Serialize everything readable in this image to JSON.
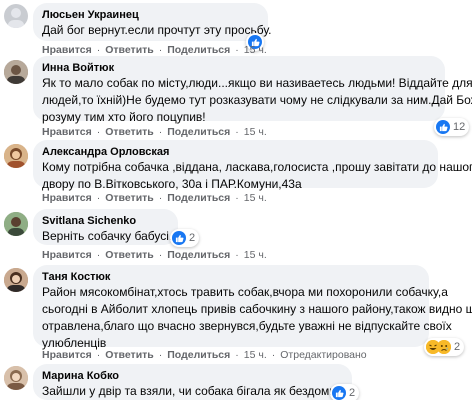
{
  "comments": [
    {
      "name": "Люсьен Украинец",
      "lines": [
        "Дай бог вернут.если прочтут эту просьбу."
      ],
      "actions": {
        "like": "Нравится",
        "reply": "Ответить",
        "share": "Поделиться",
        "time": "15 ч."
      },
      "reactions": {
        "count": ""
      }
    },
    {
      "name": "Инна Войтюк",
      "lines": [
        "Як то мало собак по місту,люди...якщо ви називаетесь людьми! Віддайте для",
        "людей,то їхній)Не будемо тут розказувати чому не слідкували за ним.Дай Боже",
        "розуму тим хто його поцупив!"
      ],
      "actions": {
        "like": "Нравится",
        "reply": "Ответить",
        "share": "Поделиться",
        "time": "15 ч."
      },
      "reactions": {
        "count": "12"
      }
    },
    {
      "name": "Александра Орловская",
      "lines": [
        "Кому потрібна собачка ,віддана, ласкава,голосиста ,прошу завітати до нашого",
        "двору по В.Вітковського, 30а і ПАР.Комуни,43а"
      ],
      "actions": {
        "like": "Нравится",
        "reply": "Ответить",
        "share": "Поделиться",
        "time": "15 ч."
      },
      "reactions": {
        "count": ""
      }
    },
    {
      "name": "Svitlana Sichenko",
      "lines": [
        "Верніть собачку бабусі..."
      ],
      "actions": {
        "like": "Нравится",
        "reply": "Ответить",
        "share": "Поделиться",
        "time": "15 ч."
      },
      "reactions": {
        "count": "2"
      }
    },
    {
      "name": "Таня Костюк",
      "lines": [
        "Район мясокомбінат,хтось травить собак,вчора ми похоронили собачку,а",
        "сьогодні в Айболит хлопець привів сабочкину з нашого району,також видно що",
        "отравлена,благо що вчасно звернувся,будьте уважні не відпускайте своїх",
        "улюбленців"
      ],
      "actions": {
        "like": "Нравится",
        "reply": "Ответить",
        "share": "Поделиться",
        "time": "15 ч.",
        "edited": "Отредактировано"
      },
      "reactions": {
        "count": "2"
      }
    },
    {
      "name": "Марина Кобко",
      "lines": [
        "Зайшли у двір та взяли, чи собака бігала як бездомні?"
      ],
      "actions": {},
      "reactions": {
        "count": "2"
      }
    }
  ],
  "colors": {
    "bubble": "#f0f2f5",
    "like_blue": "#1877f2",
    "muted_text": "#65676b",
    "haha_yellow": "#f7b928"
  },
  "icons": {
    "like": "thumbs-up-icon",
    "haha": "haha-emoji-icon",
    "sad": "sad-emoji-icon"
  }
}
